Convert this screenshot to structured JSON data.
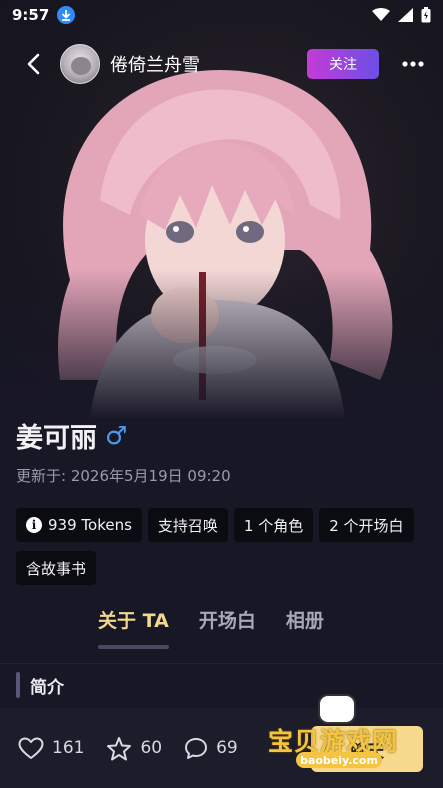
{
  "status_bar": {
    "time": "9:57",
    "icons": [
      "download-icon",
      "wifi-icon",
      "signal-icon",
      "battery-icon"
    ]
  },
  "header": {
    "author_name": "倦倚兰舟雪",
    "follow_label": "关注",
    "icons": [
      "back-arrow-icon",
      "more-dots-icon"
    ]
  },
  "profile": {
    "name": "姜可丽",
    "gender_symbol": "♂",
    "updated": "更新于: 2026年5月19日 09:20",
    "tags": [
      {
        "label": "939 Tokens",
        "icon": "info-icon"
      },
      {
        "label": "支持召唤"
      },
      {
        "label": "1 个角色"
      },
      {
        "label": "2 个开场白"
      },
      {
        "label": "含故事书"
      }
    ]
  },
  "tabs": [
    {
      "label": "关于 TA",
      "active": true
    },
    {
      "label": "开场白",
      "active": false
    },
    {
      "label": "相册",
      "active": false
    }
  ],
  "section": {
    "title": "简介"
  },
  "bottom_bar": {
    "likes": "161",
    "stars": "60",
    "comments": "69",
    "chat_label": "聊天"
  },
  "watermark": {
    "text": "宝贝游戏网",
    "url": "baobeiy.com"
  },
  "colors": {
    "background": "#181726",
    "accent_gold": "#f2d78f",
    "follow_gradient_start": "#c53bd6",
    "follow_gradient_end": "#6b4fe6",
    "gender_blue": "#4a9bf0"
  }
}
